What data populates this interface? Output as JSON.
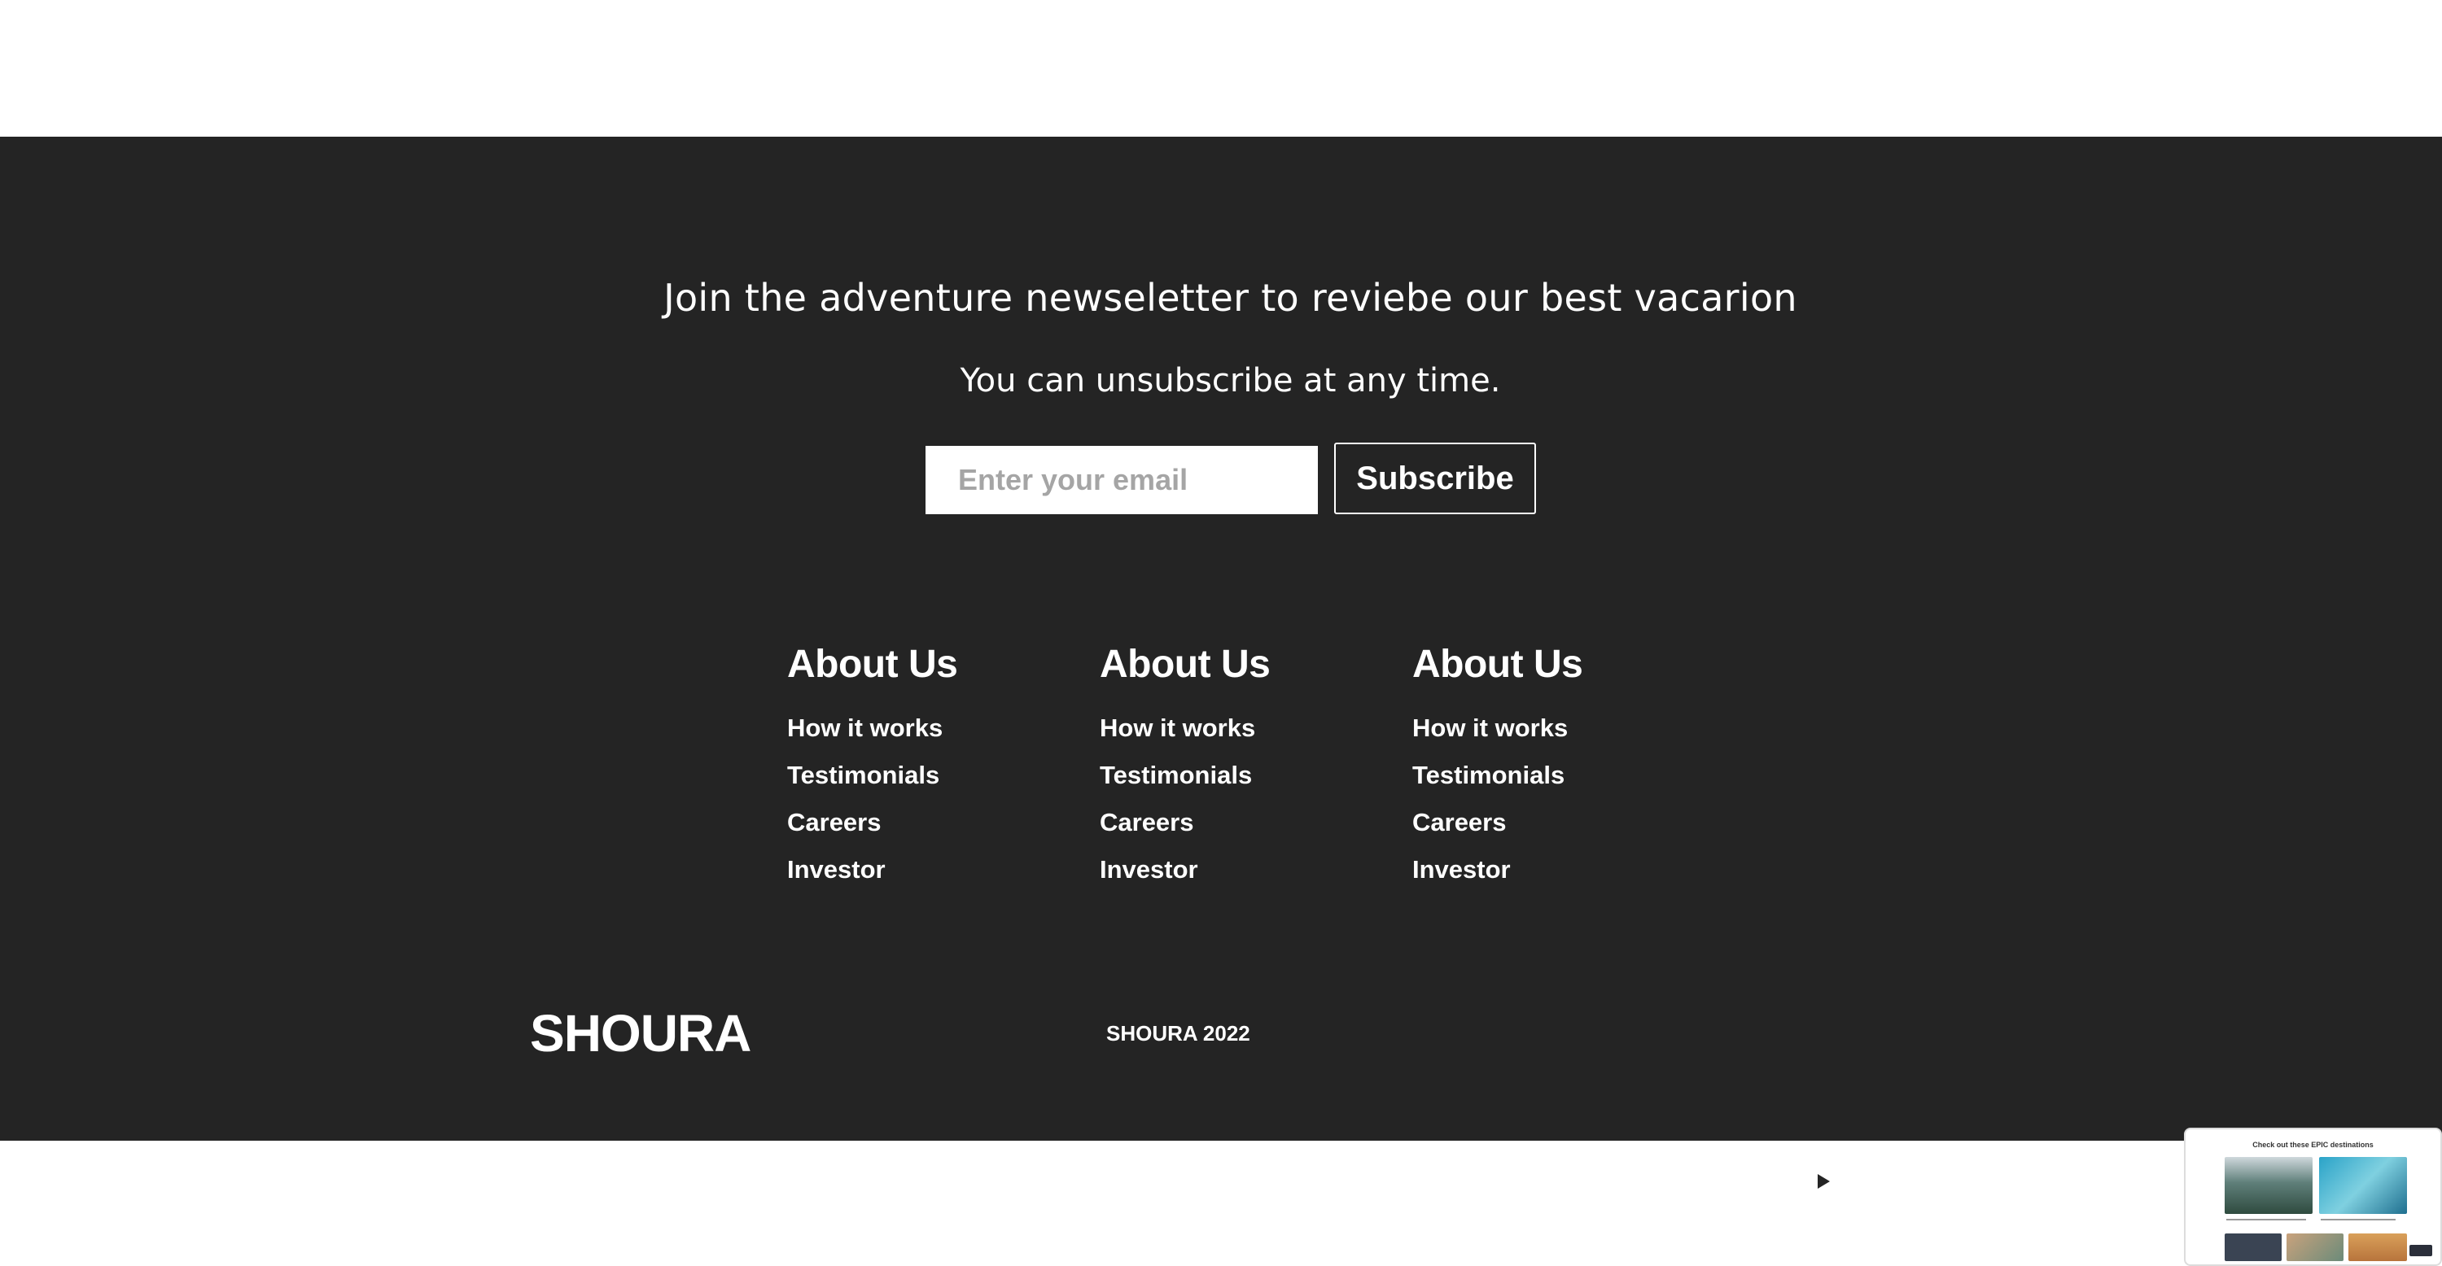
{
  "newsletter": {
    "heading": "Join the adventure newseletter to reviebe our best vacarion",
    "subheading": "You can unsubscribe at any time.",
    "email_placeholder": "Enter your email",
    "subscribe_label": "Subscribe"
  },
  "link_columns": [
    {
      "heading": "About Us",
      "links": [
        "How it works",
        "Testimonials",
        "Careers",
        "Investor"
      ]
    },
    {
      "heading": "About Us",
      "links": [
        "How it works",
        "Testimonials",
        "Careers",
        "Investor"
      ]
    },
    {
      "heading": "About Us",
      "links": [
        "How it works",
        "Testimonials",
        "Careers",
        "Investor"
      ]
    }
  ],
  "brand": {
    "logo_text": "SHOURA",
    "copyright": "SHOURA 2022"
  },
  "social_icons": [
    "facebook-icon",
    "twitter-icon",
    "youtube-icon",
    "instagram-icon"
  ],
  "colors": {
    "footer_background": "#242424",
    "text": "#ffffff",
    "placeholder": "#a5a5a5"
  },
  "popup": {
    "title": "Check out these EPIC destinations"
  }
}
